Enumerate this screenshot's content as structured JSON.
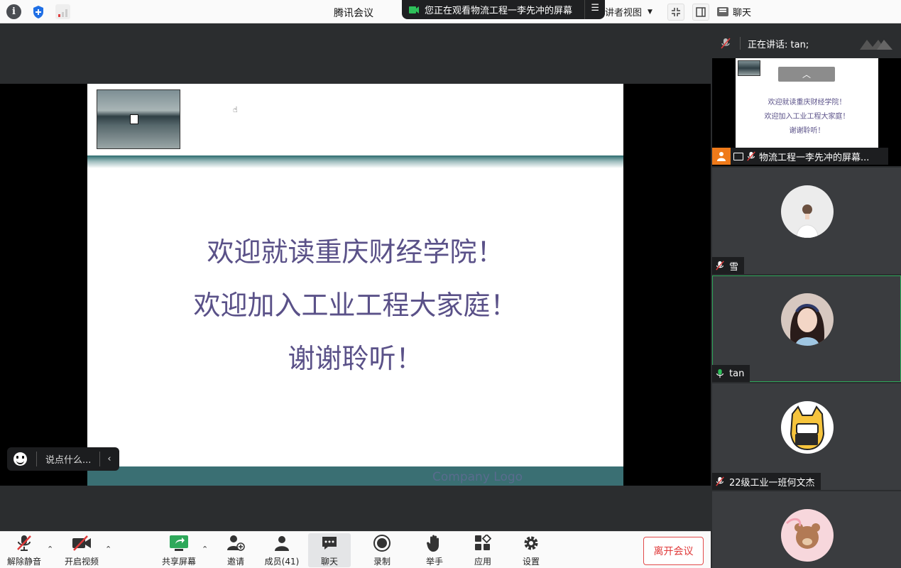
{
  "window": {
    "title": "腾讯会议"
  },
  "share_banner": {
    "text": "您正在观看物流工程一李先冲的屏幕",
    "menu_glyph": "☰"
  },
  "view_select": {
    "value": "讲者视图"
  },
  "chat_tab": {
    "label": "聊天"
  },
  "slide": {
    "lines": [
      "欢迎就读重庆财经学院！",
      "欢迎加入工业工程大家庭！",
      "谢谢聆听！"
    ],
    "logo_text": "Company Logo"
  },
  "say_box": {
    "placeholder": "说点什么..."
  },
  "toolbar": {
    "unmute": "解除静音",
    "video": "开启视频",
    "share": "共享屏幕",
    "invite": "邀请",
    "members": "成员(41)",
    "chat": "聊天",
    "record": "录制",
    "raise_hand": "举手",
    "apps": "应用",
    "settings": "设置",
    "leave": "离开会议"
  },
  "right_panel": {
    "speaking": "正在讲话: tan;",
    "share_tile": {
      "name": "物流工程一李先冲的屏幕...",
      "mini_lines": [
        "欢迎就读重庆财经学院！",
        "欢迎加入工业工程大家庭！",
        "谢谢聆听！"
      ]
    },
    "participants": [
      {
        "name": "雪",
        "muted": true
      },
      {
        "name": "tan",
        "muted": false,
        "speaking": true
      },
      {
        "name": "22级工业一班何文杰",
        "muted": true
      },
      {
        "name": "",
        "muted": true
      }
    ]
  },
  "colors": {
    "accent_green": "#2ea85a",
    "leave_red": "#e03a3a",
    "slide_text": "#5a5188",
    "share_orange": "#ef7a1a"
  }
}
